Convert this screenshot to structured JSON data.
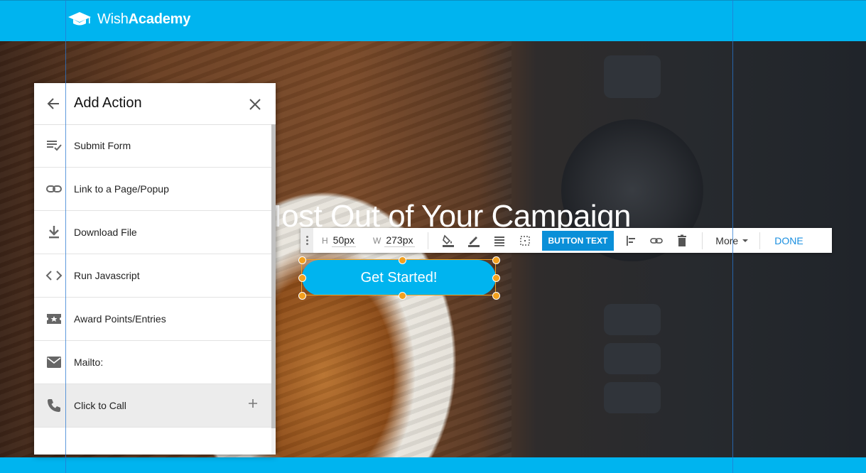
{
  "header": {
    "brand_part1": "Wish",
    "brand_part2": "Academy",
    "logo_icon": "graduation-cap-icon",
    "bg_color": "#00b4ef"
  },
  "hero": {
    "headline": "Most Out of Your Campaign",
    "cta_label": "Get Started!",
    "cta_color": "#00b4ef"
  },
  "toolbar": {
    "height_label": "H",
    "height_value": "50px",
    "width_label": "W",
    "width_value": "273px",
    "button_text_label": "BUTTON TEXT",
    "more_label": "More",
    "done_label": "DONE",
    "icons": [
      "grip-icon",
      "fill-color-icon",
      "pen-icon",
      "align-lines-icon",
      "border-icon",
      "align-left-icon",
      "link-icon",
      "trash-icon",
      "caret-down-icon"
    ]
  },
  "panel": {
    "title": "Add Action",
    "items": [
      {
        "label": "Submit Form",
        "icon": "playlist-check-icon"
      },
      {
        "label": "Link to a Page/Popup",
        "icon": "link-icon"
      },
      {
        "label": "Download File",
        "icon": "download-icon"
      },
      {
        "label": "Run Javascript",
        "icon": "code-icon"
      },
      {
        "label": "Award Points/Entries",
        "icon": "ticket-star-icon"
      },
      {
        "label": "Mailto:",
        "icon": "mail-icon"
      },
      {
        "label": "Click to Call",
        "icon": "phone-icon",
        "active": true
      }
    ]
  },
  "colors": {
    "selection": "#f2a01e",
    "button_text_bg": "#0a8fd8",
    "done": "#1a8fe0"
  }
}
